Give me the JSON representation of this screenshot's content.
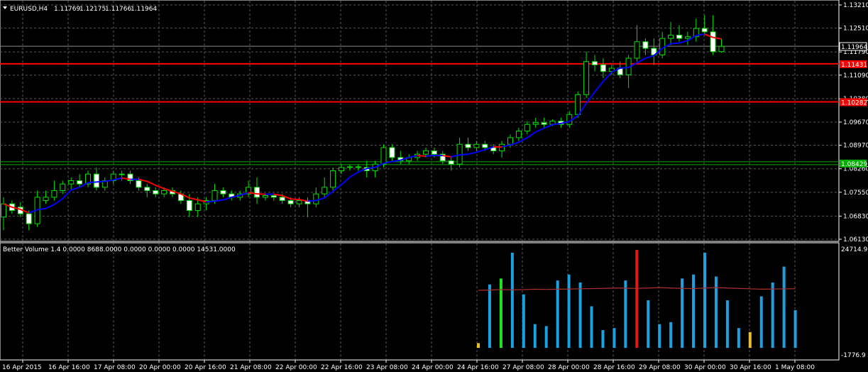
{
  "chart_data": {
    "type": "candlestick",
    "symbol_header": {
      "symbol_tf": "EURUSD,H4",
      "ohlc": [
        "1.11769",
        "1.12175",
        "1.11766",
        "1.11964"
      ]
    },
    "price_axis": {
      "ylim": [
        1.0613,
        1.1321
      ],
      "ticks": [
        "1.13210",
        "1.12510",
        "1.11790",
        "1.11090",
        "1.10380",
        "1.09670",
        "1.08970",
        "1.08260",
        "1.07550",
        "1.06830",
        "1.06130"
      ]
    },
    "current_price": "1.11964",
    "horizontal_lines": [
      {
        "price": 1.11431,
        "label": "1.11431",
        "color": "#ff0000"
      },
      {
        "price": 1.10282,
        "label": "1.10282",
        "color": "#ff0000"
      },
      {
        "price": 1.08429,
        "label": "1.08429",
        "color": "#00b000"
      }
    ],
    "time_axis": {
      "labels": [
        "16 Apr 2015",
        "16 Apr 16:00",
        "17 Apr 08:00",
        "20 Apr 00:00",
        "20 Apr 16:00",
        "21 Apr 08:00",
        "22 Apr 00:00",
        "22 Apr 16:00",
        "23 Apr 08:00",
        "24 Apr 00:00",
        "24 Apr 16:00",
        "27 Apr 08:00",
        "28 Apr 00:00",
        "28 Apr 16:00",
        "29 Apr 08:00",
        "30 Apr 00:00",
        "30 Apr 16:00",
        "1 May 08:00"
      ]
    },
    "candles": [
      {
        "o": 1.068,
        "h": 1.074,
        "l": 1.064,
        "c": 1.072
      },
      {
        "o": 1.072,
        "h": 1.073,
        "l": 1.069,
        "c": 1.07
      },
      {
        "o": 1.071,
        "h": 1.0725,
        "l": 1.068,
        "c": 1.069
      },
      {
        "o": 1.069,
        "h": 1.07,
        "l": 1.064,
        "c": 1.066
      },
      {
        "o": 1.066,
        "h": 1.076,
        "l": 1.065,
        "c": 1.074
      },
      {
        "o": 1.073,
        "h": 1.076,
        "l": 1.072,
        "c": 1.074
      },
      {
        "o": 1.074,
        "h": 1.079,
        "l": 1.073,
        "c": 1.076
      },
      {
        "o": 1.076,
        "h": 1.079,
        "l": 1.075,
        "c": 1.078
      },
      {
        "o": 1.078,
        "h": 1.08,
        "l": 1.076,
        "c": 1.079
      },
      {
        "o": 1.079,
        "h": 1.081,
        "l": 1.077,
        "c": 1.078
      },
      {
        "o": 1.078,
        "h": 1.082,
        "l": 1.077,
        "c": 1.081
      },
      {
        "o": 1.081,
        "h": 1.083,
        "l": 1.076,
        "c": 1.077
      },
      {
        "o": 1.077,
        "h": 1.08,
        "l": 1.076,
        "c": 1.079
      },
      {
        "o": 1.079,
        "h": 1.082,
        "l": 1.078,
        "c": 1.081
      },
      {
        "o": 1.081,
        "h": 1.082,
        "l": 1.079,
        "c": 1.081
      },
      {
        "o": 1.081,
        "h": 1.082,
        "l": 1.078,
        "c": 1.079
      },
      {
        "o": 1.079,
        "h": 1.08,
        "l": 1.076,
        "c": 1.077
      },
      {
        "o": 1.077,
        "h": 1.078,
        "l": 1.074,
        "c": 1.076
      },
      {
        "o": 1.076,
        "h": 1.077,
        "l": 1.074,
        "c": 1.075
      },
      {
        "o": 1.075,
        "h": 1.077,
        "l": 1.074,
        "c": 1.076
      },
      {
        "o": 1.076,
        "h": 1.077,
        "l": 1.074,
        "c": 1.075
      },
      {
        "o": 1.075,
        "h": 1.076,
        "l": 1.072,
        "c": 1.073
      },
      {
        "o": 1.073,
        "h": 1.075,
        "l": 1.068,
        "c": 1.07
      },
      {
        "o": 1.07,
        "h": 1.074,
        "l": 1.068,
        "c": 1.072
      },
      {
        "o": 1.072,
        "h": 1.074,
        "l": 1.07,
        "c": 1.073
      },
      {
        "o": 1.073,
        "h": 1.078,
        "l": 1.072,
        "c": 1.076
      },
      {
        "o": 1.076,
        "h": 1.077,
        "l": 1.074,
        "c": 1.075
      },
      {
        "o": 1.075,
        "h": 1.076,
        "l": 1.073,
        "c": 1.074
      },
      {
        "o": 1.074,
        "h": 1.076,
        "l": 1.073,
        "c": 1.075
      },
      {
        "o": 1.075,
        "h": 1.079,
        "l": 1.074,
        "c": 1.077
      },
      {
        "o": 1.077,
        "h": 1.08,
        "l": 1.072,
        "c": 1.074
      },
      {
        "o": 1.074,
        "h": 1.075,
        "l": 1.073,
        "c": 1.0745
      },
      {
        "o": 1.0745,
        "h": 1.075,
        "l": 1.073,
        "c": 1.074
      },
      {
        "o": 1.074,
        "h": 1.075,
        "l": 1.072,
        "c": 1.073
      },
      {
        "o": 1.073,
        "h": 1.074,
        "l": 1.071,
        "c": 1.072
      },
      {
        "o": 1.072,
        "h": 1.074,
        "l": 1.071,
        "c": 1.073
      },
      {
        "o": 1.073,
        "h": 1.074,
        "l": 1.068,
        "c": 1.072
      },
      {
        "o": 1.072,
        "h": 1.077,
        "l": 1.071,
        "c": 1.075
      },
      {
        "o": 1.075,
        "h": 1.08,
        "l": 1.074,
        "c": 1.077
      },
      {
        "o": 1.077,
        "h": 1.083,
        "l": 1.076,
        "c": 1.082
      },
      {
        "o": 1.082,
        "h": 1.084,
        "l": 1.081,
        "c": 1.083
      },
      {
        "o": 1.083,
        "h": 1.084,
        "l": 1.082,
        "c": 1.0832
      },
      {
        "o": 1.0832,
        "h": 1.084,
        "l": 1.082,
        "c": 1.083
      },
      {
        "o": 1.083,
        "h": 1.085,
        "l": 1.08,
        "c": 1.082
      },
      {
        "o": 1.082,
        "h": 1.085,
        "l": 1.08,
        "c": 1.084
      },
      {
        "o": 1.084,
        "h": 1.09,
        "l": 1.083,
        "c": 1.089
      },
      {
        "o": 1.089,
        "h": 1.09,
        "l": 1.085,
        "c": 1.086
      },
      {
        "o": 1.086,
        "h": 1.088,
        "l": 1.084,
        "c": 1.085
      },
      {
        "o": 1.085,
        "h": 1.087,
        "l": 1.084,
        "c": 1.086
      },
      {
        "o": 1.086,
        "h": 1.088,
        "l": 1.085,
        "c": 1.087
      },
      {
        "o": 1.087,
        "h": 1.089,
        "l": 1.086,
        "c": 1.088
      },
      {
        "o": 1.088,
        "h": 1.089,
        "l": 1.086,
        "c": 1.087
      },
      {
        "o": 1.087,
        "h": 1.088,
        "l": 1.084,
        "c": 1.085
      },
      {
        "o": 1.085,
        "h": 1.086,
        "l": 1.082,
        "c": 1.084
      },
      {
        "o": 1.084,
        "h": 1.092,
        "l": 1.083,
        "c": 1.09
      },
      {
        "o": 1.09,
        "h": 1.092,
        "l": 1.088,
        "c": 1.089
      },
      {
        "o": 1.089,
        "h": 1.091,
        "l": 1.088,
        "c": 1.09
      },
      {
        "o": 1.09,
        "h": 1.091,
        "l": 1.088,
        "c": 1.089
      },
      {
        "o": 1.089,
        "h": 1.09,
        "l": 1.087,
        "c": 1.088
      },
      {
        "o": 1.088,
        "h": 1.091,
        "l": 1.086,
        "c": 1.09
      },
      {
        "o": 1.09,
        "h": 1.093,
        "l": 1.089,
        "c": 1.092
      },
      {
        "o": 1.092,
        "h": 1.095,
        "l": 1.091,
        "c": 1.094
      },
      {
        "o": 1.094,
        "h": 1.097,
        "l": 1.093,
        "c": 1.096
      },
      {
        "o": 1.096,
        "h": 1.098,
        "l": 1.095,
        "c": 1.0965
      },
      {
        "o": 1.0965,
        "h": 1.098,
        "l": 1.095,
        "c": 1.096
      },
      {
        "o": 1.096,
        "h": 1.0975,
        "l": 1.0955,
        "c": 1.097
      },
      {
        "o": 1.097,
        "h": 1.098,
        "l": 1.095,
        "c": 1.096
      },
      {
        "o": 1.096,
        "h": 1.1,
        "l": 1.095,
        "c": 1.099
      },
      {
        "o": 1.099,
        "h": 1.106,
        "l": 1.098,
        "c": 1.105
      },
      {
        "o": 1.105,
        "h": 1.118,
        "l": 1.104,
        "c": 1.115
      },
      {
        "o": 1.115,
        "h": 1.117,
        "l": 1.112,
        "c": 1.114
      },
      {
        "o": 1.114,
        "h": 1.116,
        "l": 1.11,
        "c": 1.112
      },
      {
        "o": 1.112,
        "h": 1.114,
        "l": 1.111,
        "c": 1.113
      },
      {
        "o": 1.113,
        "h": 1.115,
        "l": 1.11,
        "c": 1.111
      },
      {
        "o": 1.111,
        "h": 1.117,
        "l": 1.107,
        "c": 1.116
      },
      {
        "o": 1.116,
        "h": 1.126,
        "l": 1.115,
        "c": 1.121
      },
      {
        "o": 1.121,
        "h": 1.122,
        "l": 1.117,
        "c": 1.119
      },
      {
        "o": 1.119,
        "h": 1.122,
        "l": 1.114,
        "c": 1.117
      },
      {
        "o": 1.117,
        "h": 1.124,
        "l": 1.116,
        "c": 1.122
      },
      {
        "o": 1.122,
        "h": 1.127,
        "l": 1.12,
        "c": 1.123
      },
      {
        "o": 1.123,
        "h": 1.126,
        "l": 1.121,
        "c": 1.122
      },
      {
        "o": 1.122,
        "h": 1.124,
        "l": 1.12,
        "c": 1.1225
      },
      {
        "o": 1.1225,
        "h": 1.128,
        "l": 1.121,
        "c": 1.125
      },
      {
        "o": 1.125,
        "h": 1.129,
        "l": 1.123,
        "c": 1.124
      },
      {
        "o": 1.124,
        "h": 1.129,
        "l": 1.117,
        "c": 1.118
      },
      {
        "o": 1.118,
        "h": 1.122,
        "l": 1.1177,
        "c": 1.1196
      }
    ],
    "ma_colors": {
      "up": "#0000ff",
      "down": "#ff0000"
    },
    "volume_indicator": {
      "header": "Better Volume 1.4 0.0000 8688.0000 0.0000 0.0000 0.0000 14531.0000",
      "max_label": "24714.9",
      "min_label": "-1776.9",
      "ylim": [
        -1776.9,
        24714.9
      ],
      "bars": [
        {
          "v": 1200,
          "color": "#e8c020"
        },
        {
          "v": 16000,
          "color": "#1e9fe0"
        },
        {
          "v": 17500,
          "color": "#22e022"
        },
        {
          "v": 24000,
          "color": "#1e9fe0"
        },
        {
          "v": 13500,
          "color": "#1e9fe0"
        },
        {
          "v": 6000,
          "color": "#1e9fe0"
        },
        {
          "v": 5500,
          "color": "#1e9fe0"
        },
        {
          "v": 17000,
          "color": "#1e9fe0"
        },
        {
          "v": 18500,
          "color": "#1e9fe0"
        },
        {
          "v": 16500,
          "color": "#1e9fe0"
        },
        {
          "v": 10500,
          "color": "#1e9fe0"
        },
        {
          "v": 4500,
          "color": "#1e9fe0"
        },
        {
          "v": 5000,
          "color": "#1e9fe0"
        },
        {
          "v": 17000,
          "color": "#1e9fe0"
        },
        {
          "v": 24700,
          "color": "#e01818"
        },
        {
          "v": 12000,
          "color": "#1e9fe0"
        },
        {
          "v": 6000,
          "color": "#1e9fe0"
        },
        {
          "v": 6500,
          "color": "#1e9fe0"
        },
        {
          "v": 17500,
          "color": "#1e9fe0"
        },
        {
          "v": 18500,
          "color": "#1e9fe0"
        },
        {
          "v": 24000,
          "color": "#1e9fe0"
        },
        {
          "v": 18000,
          "color": "#1e9fe0"
        },
        {
          "v": 12000,
          "color": "#1e9fe0"
        },
        {
          "v": 5000,
          "color": "#1e9fe0"
        },
        {
          "v": 4000,
          "color": "#e8c020"
        },
        {
          "v": 13000,
          "color": "#1e9fe0"
        },
        {
          "v": 16500,
          "color": "#1e9fe0"
        },
        {
          "v": 20500,
          "color": "#1e9fe0"
        },
        {
          "v": 9500,
          "color": "#1e9fe0"
        }
      ],
      "avg_line": [
        14531,
        14600,
        14700,
        14650,
        14700,
        14800,
        14750,
        14800,
        14850,
        14900,
        14950,
        15000,
        15100,
        15050,
        15000,
        15100,
        15200,
        15100,
        15000,
        14950,
        15100,
        15200,
        15100,
        15000,
        14900,
        14800,
        14850,
        14900,
        14900
      ]
    }
  }
}
